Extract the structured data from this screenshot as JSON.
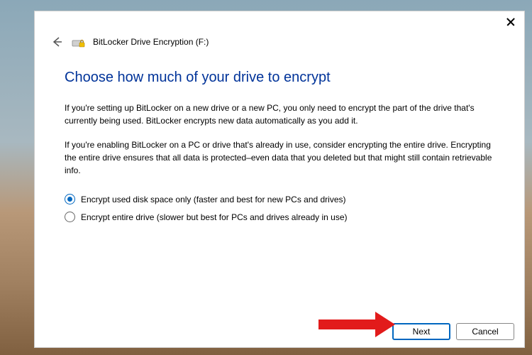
{
  "window": {
    "breadcrumb": "BitLocker Drive Encryption (F:)"
  },
  "content": {
    "heading": "Choose how much of your drive to encrypt",
    "para1": "If you're setting up BitLocker on a new drive or a new PC, you only need to encrypt the part of the drive that's currently being used. BitLocker encrypts new data automatically as you add it.",
    "para2": "If you're enabling BitLocker on a PC or drive that's already in use, consider encrypting the entire drive. Encrypting the entire drive ensures that all data is protected–even data that you deleted but that might still contain retrievable info."
  },
  "options": {
    "opt1": "Encrypt used disk space only (faster and best for new PCs and drives)",
    "opt2": "Encrypt entire drive (slower but best for PCs and drives already in use)",
    "selected": 0
  },
  "buttons": {
    "next": "Next",
    "cancel": "Cancel"
  }
}
